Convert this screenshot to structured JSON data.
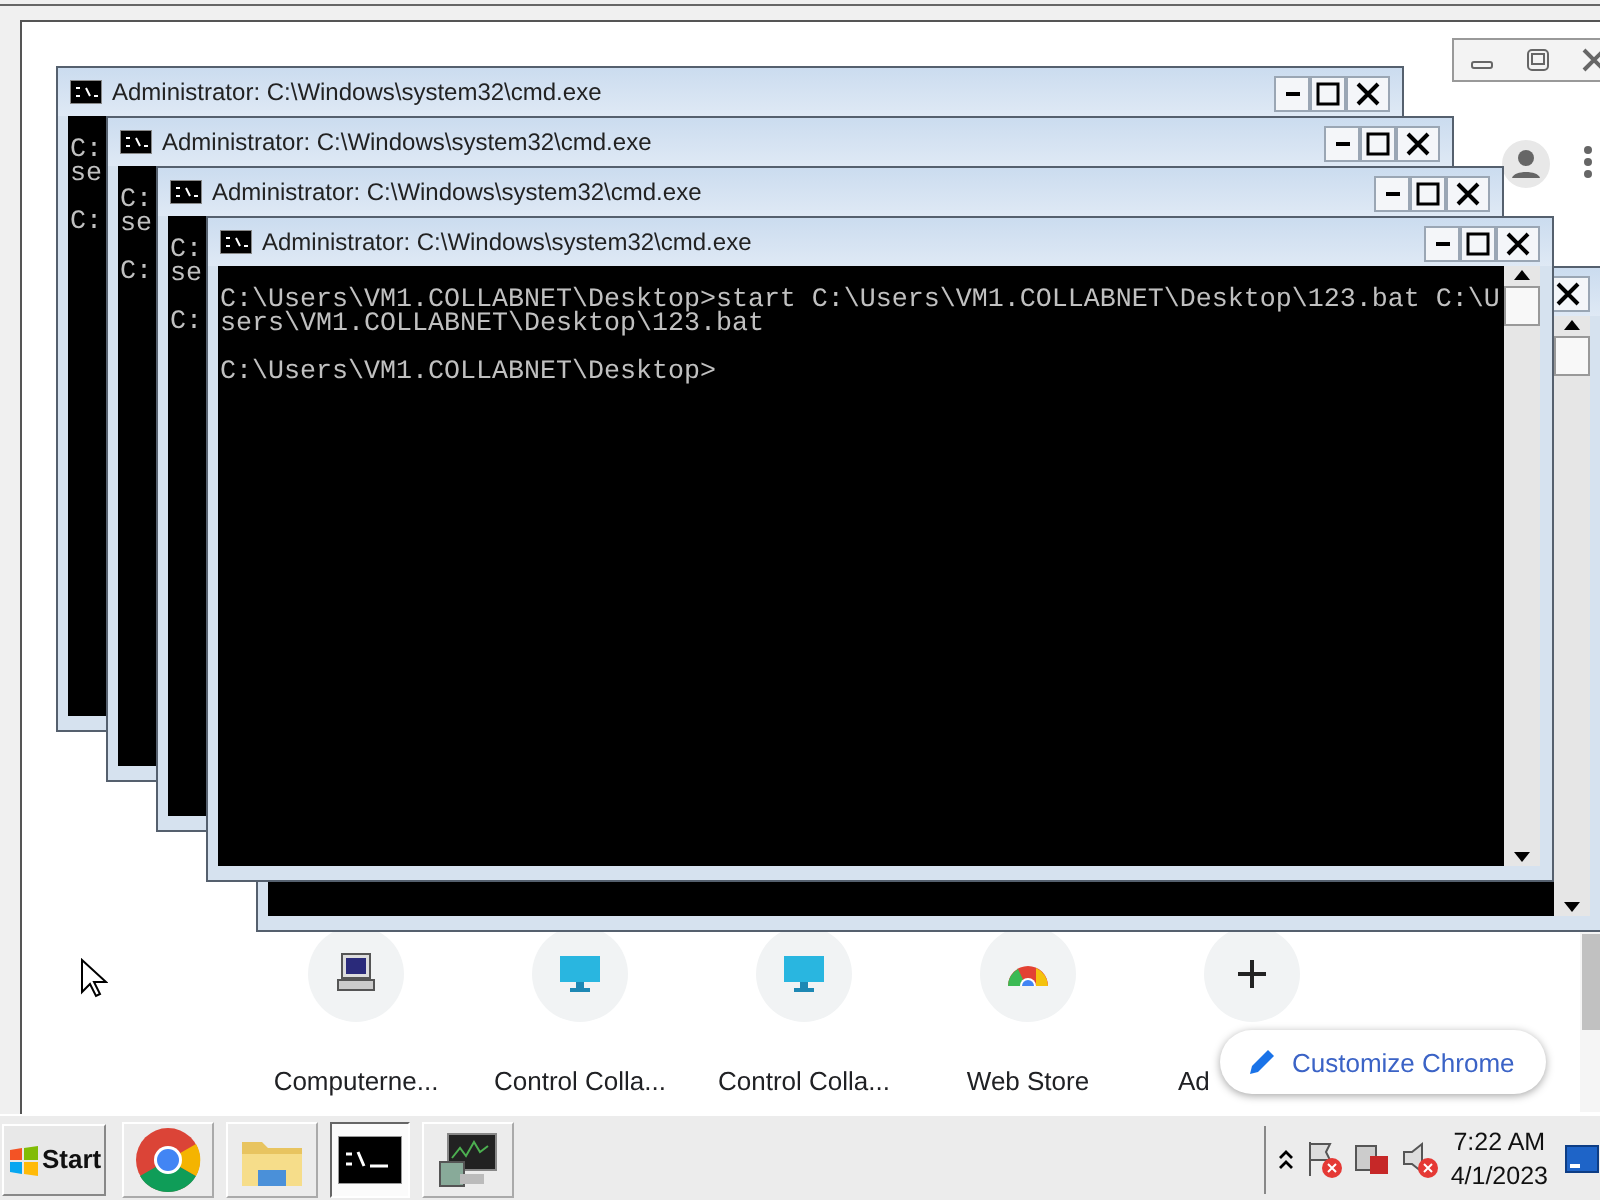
{
  "browser": {
    "shortcuts": [
      {
        "label": "Computerne...",
        "kind": "computer"
      },
      {
        "label": "Control Colla...",
        "kind": "monitor"
      },
      {
        "label": "Control Colla...",
        "kind": "monitor"
      },
      {
        "label": "Web Store",
        "kind": "store"
      },
      {
        "label": "Ad",
        "kind": "add"
      }
    ],
    "customize_button": "Customize Chrome"
  },
  "cmd_windows": [
    {
      "title": "Administrator: C:\\Windows\\system32\\cmd.exe",
      "blocks": [
        [
          "C:",
          "se"
        ],
        [
          "C:"
        ]
      ]
    },
    {
      "title": "Administrator: C:\\Windows\\system32\\cmd.exe",
      "blocks": [
        [
          "C:",
          "se"
        ],
        [
          "C:"
        ]
      ]
    },
    {
      "title": "Administrator: C:\\Windows\\system32\\cmd.exe",
      "blocks": [
        [
          "C:",
          "se"
        ],
        [
          "C:"
        ]
      ]
    },
    {
      "title": "Administrator: C:\\Windows\\system32\\cmd.exe",
      "blocks": [
        [
          "C:\\Users\\VM1.COLLABNET\\Desktop>start C:\\Users\\VM1.COLLABNET\\Desktop\\123.bat C:\\U",
          "sers\\VM1.COLLABNET\\Desktop\\123.bat"
        ],
        [
          "C:\\Users\\VM1.COLLABNET\\Desktop>"
        ]
      ]
    }
  ],
  "taskbar": {
    "start": "Start",
    "apps": [
      {
        "kind": "browser",
        "selected": false
      },
      {
        "kind": "folder",
        "selected": false
      },
      {
        "kind": "console",
        "selected": true
      },
      {
        "kind": "monitor",
        "selected": false
      }
    ],
    "time": "7:22 AM",
    "date": "4/1/2023"
  }
}
